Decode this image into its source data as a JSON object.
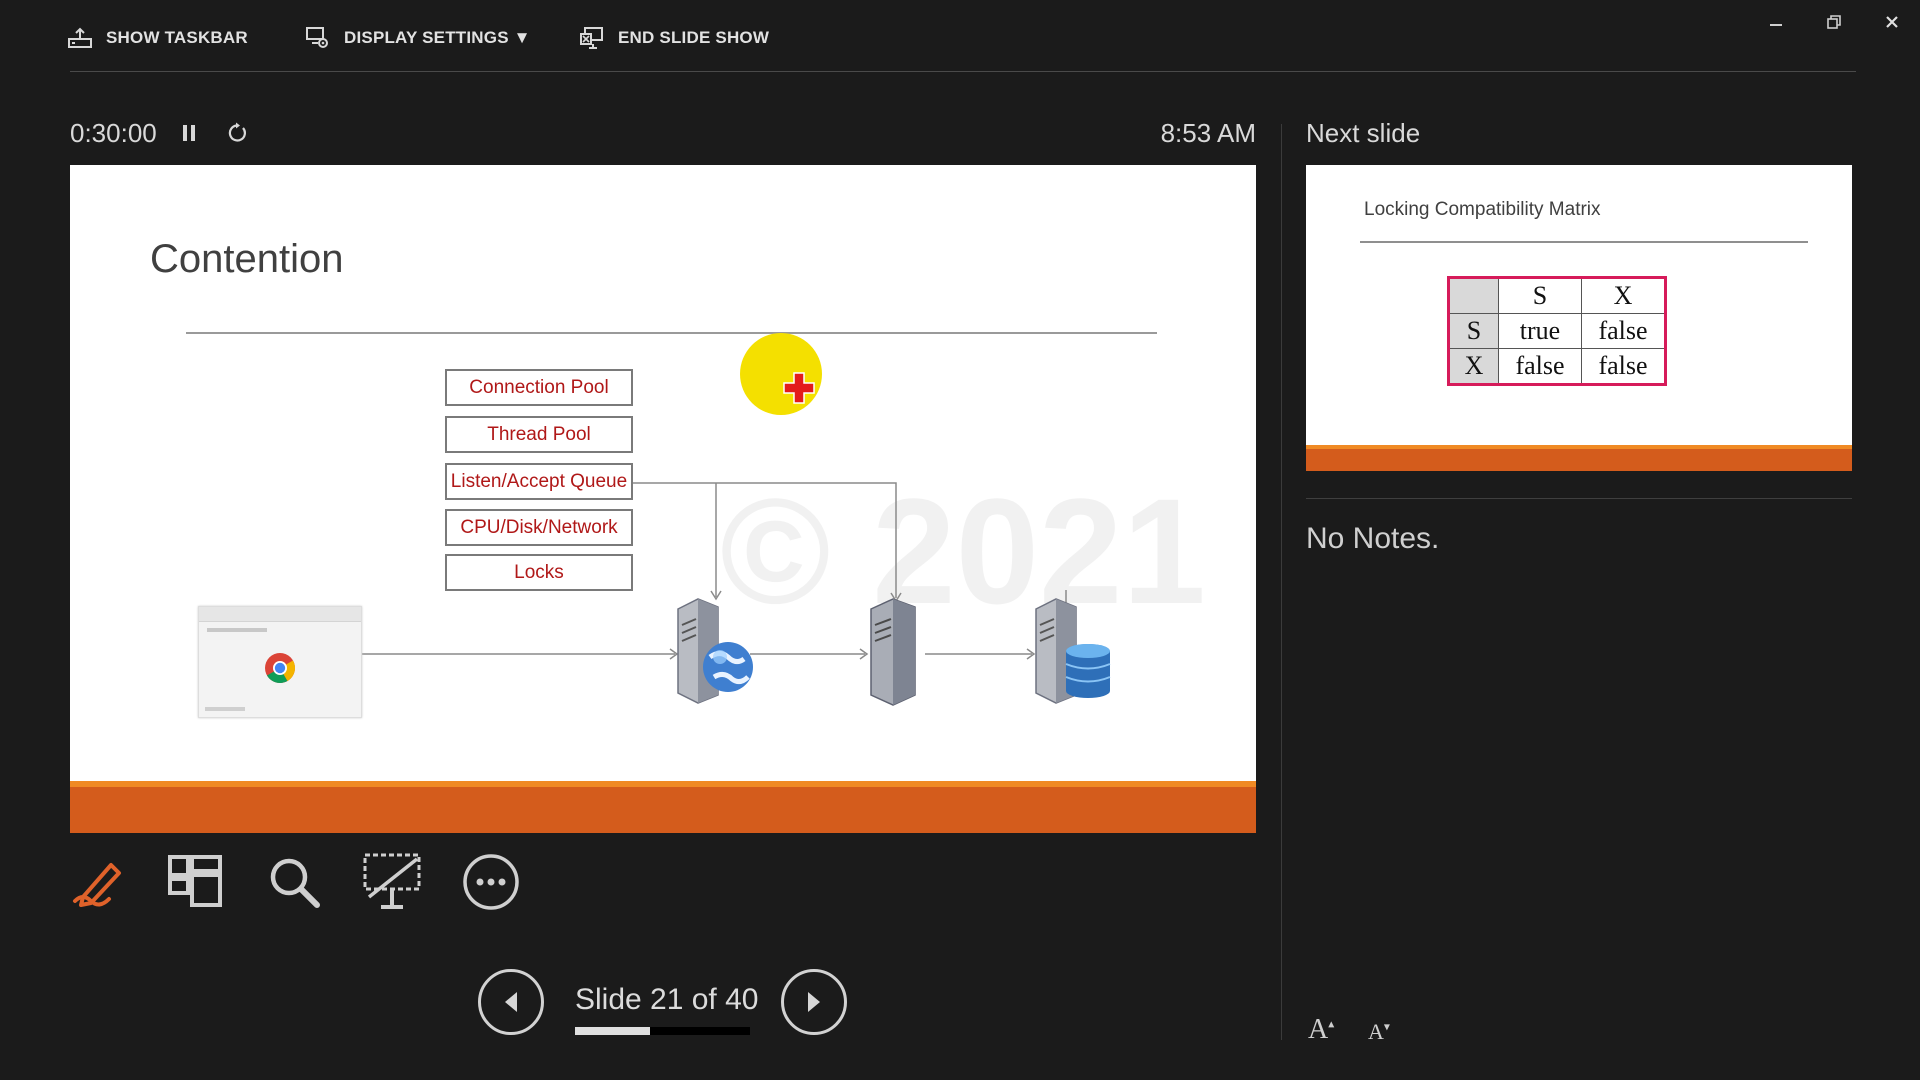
{
  "toolbar": {
    "show_taskbar": "SHOW TASKBAR",
    "display_settings": "DISPLAY SETTINGS ▼",
    "end_slide_show": "END SLIDE SHOW"
  },
  "presenter": {
    "timer": "0:30:00",
    "clock": "8:53 AM",
    "next_slide_label": "Next slide",
    "notes": "No Notes."
  },
  "current_slide": {
    "title": "Contention",
    "stack": [
      "Connection Pool",
      "Thread Pool",
      "Listen/Accept Queue",
      "CPU/Disk/Network",
      "Locks"
    ]
  },
  "next_slide": {
    "title": "Locking Compatibility Matrix",
    "matrix": {
      "header": [
        "",
        "S",
        "X"
      ],
      "rows": [
        [
          "S",
          "true",
          "false"
        ],
        [
          "X",
          "false",
          "false"
        ]
      ]
    }
  },
  "navigation": {
    "counter": "Slide 21 of 40",
    "current": 21,
    "total": 40,
    "progress": 0.43
  },
  "font_controls": {
    "increase": "A",
    "decrease": "A"
  },
  "colors": {
    "accent": "#d45c1c",
    "accent_light": "#f08a24",
    "stack_text": "#b01818",
    "laser": "#f4e000",
    "matrix_border": "#d61b5a"
  }
}
